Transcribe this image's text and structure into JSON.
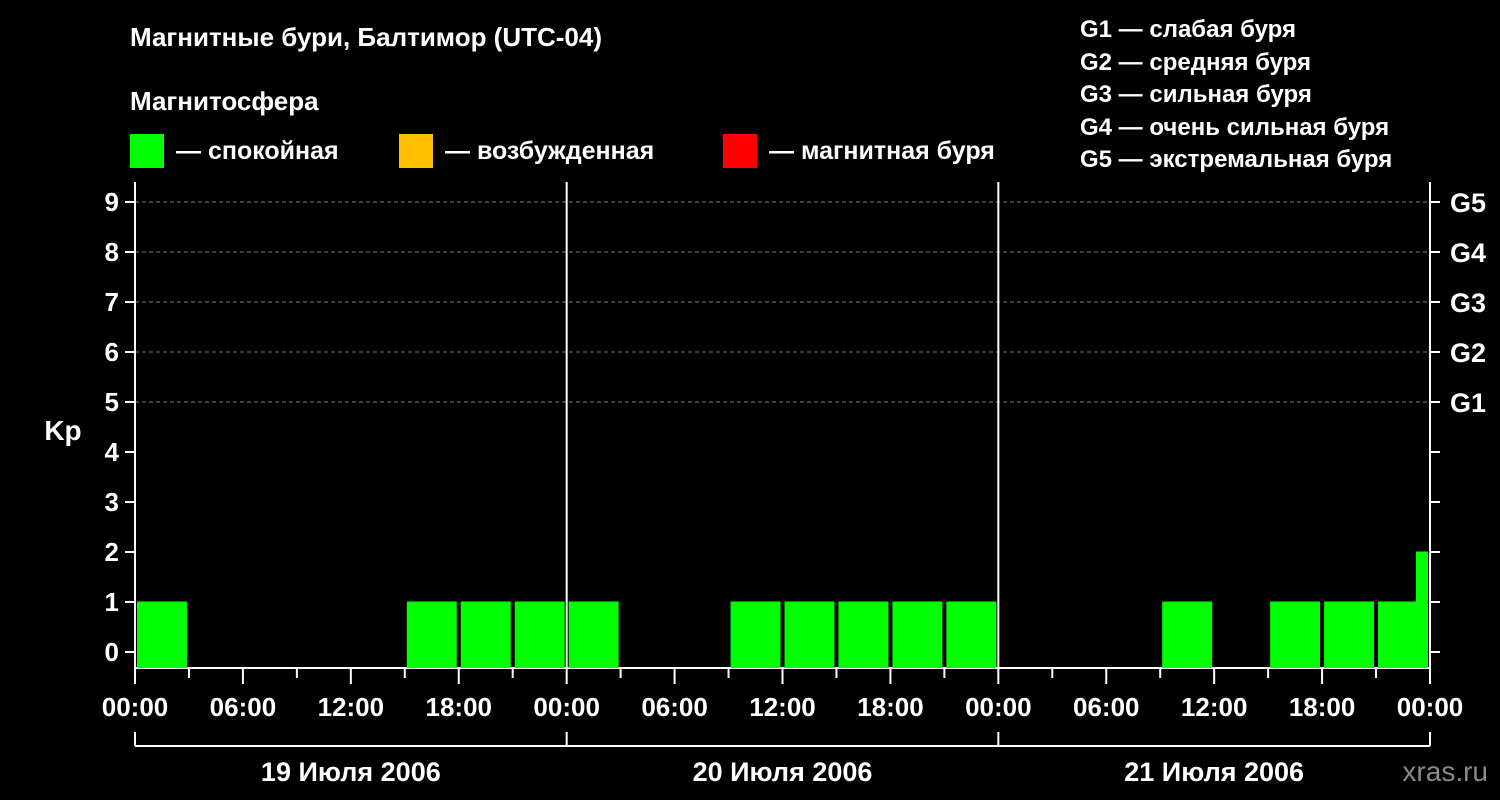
{
  "title": "Магнитные бури, Балтимор (UTC-04)",
  "subtitle": "Магнитосфера",
  "legend": [
    {
      "label": "— спокойная",
      "color": "#00ff00"
    },
    {
      "label": "— возбужденная",
      "color": "#ffbf00"
    },
    {
      "label": "— магнитная буря",
      "color": "#ff0000"
    }
  ],
  "g_legend": [
    "G1 — слабая буря",
    "G2 — средняя буря",
    "G3 — сильная буря",
    "G4 — очень сильная буря",
    "G5 — экстремальная буря"
  ],
  "watermark": "xras.ru",
  "chart_data": {
    "type": "bar",
    "ylabel": "Kp",
    "ylim": [
      0,
      9
    ],
    "yticks": [
      0,
      1,
      2,
      3,
      4,
      5,
      6,
      7,
      8,
      9
    ],
    "right_ticks": [
      {
        "value": 5,
        "label": "G1"
      },
      {
        "value": 6,
        "label": "G2"
      },
      {
        "value": 7,
        "label": "G3"
      },
      {
        "value": 8,
        "label": "G4"
      },
      {
        "value": 9,
        "label": "G5"
      }
    ],
    "xlim_hours": [
      0,
      72
    ],
    "xtick_labels": [
      "00:00",
      "06:00",
      "12:00",
      "18:00",
      "00:00",
      "06:00",
      "12:00",
      "18:00",
      "00:00",
      "06:00",
      "12:00",
      "18:00",
      "00:00"
    ],
    "days": [
      "19 Июля 2006",
      "20 Июля 2006",
      "21 Июля 2006"
    ],
    "grid": "dashed horizontal at 5-9",
    "series": [
      {
        "bars": [
          {
            "start_hour": 0,
            "kp": 1
          },
          {
            "start_hour": 15,
            "kp": 1
          },
          {
            "start_hour": 18,
            "kp": 1
          },
          {
            "start_hour": 21,
            "kp": 1
          },
          {
            "start_hour": 24,
            "kp": 1
          },
          {
            "start_hour": 33,
            "kp": 1
          },
          {
            "start_hour": 36,
            "kp": 1
          },
          {
            "start_hour": 39,
            "kp": 1
          },
          {
            "start_hour": 42,
            "kp": 1
          },
          {
            "start_hour": 45,
            "kp": 1
          },
          {
            "start_hour": 57,
            "kp": 1
          },
          {
            "start_hour": 63,
            "kp": 1
          },
          {
            "start_hour": 66,
            "kp": 1
          },
          {
            "start_hour": 69,
            "kp": 1
          },
          {
            "start_hour": 72,
            "kp": 2
          }
        ]
      }
    ]
  }
}
